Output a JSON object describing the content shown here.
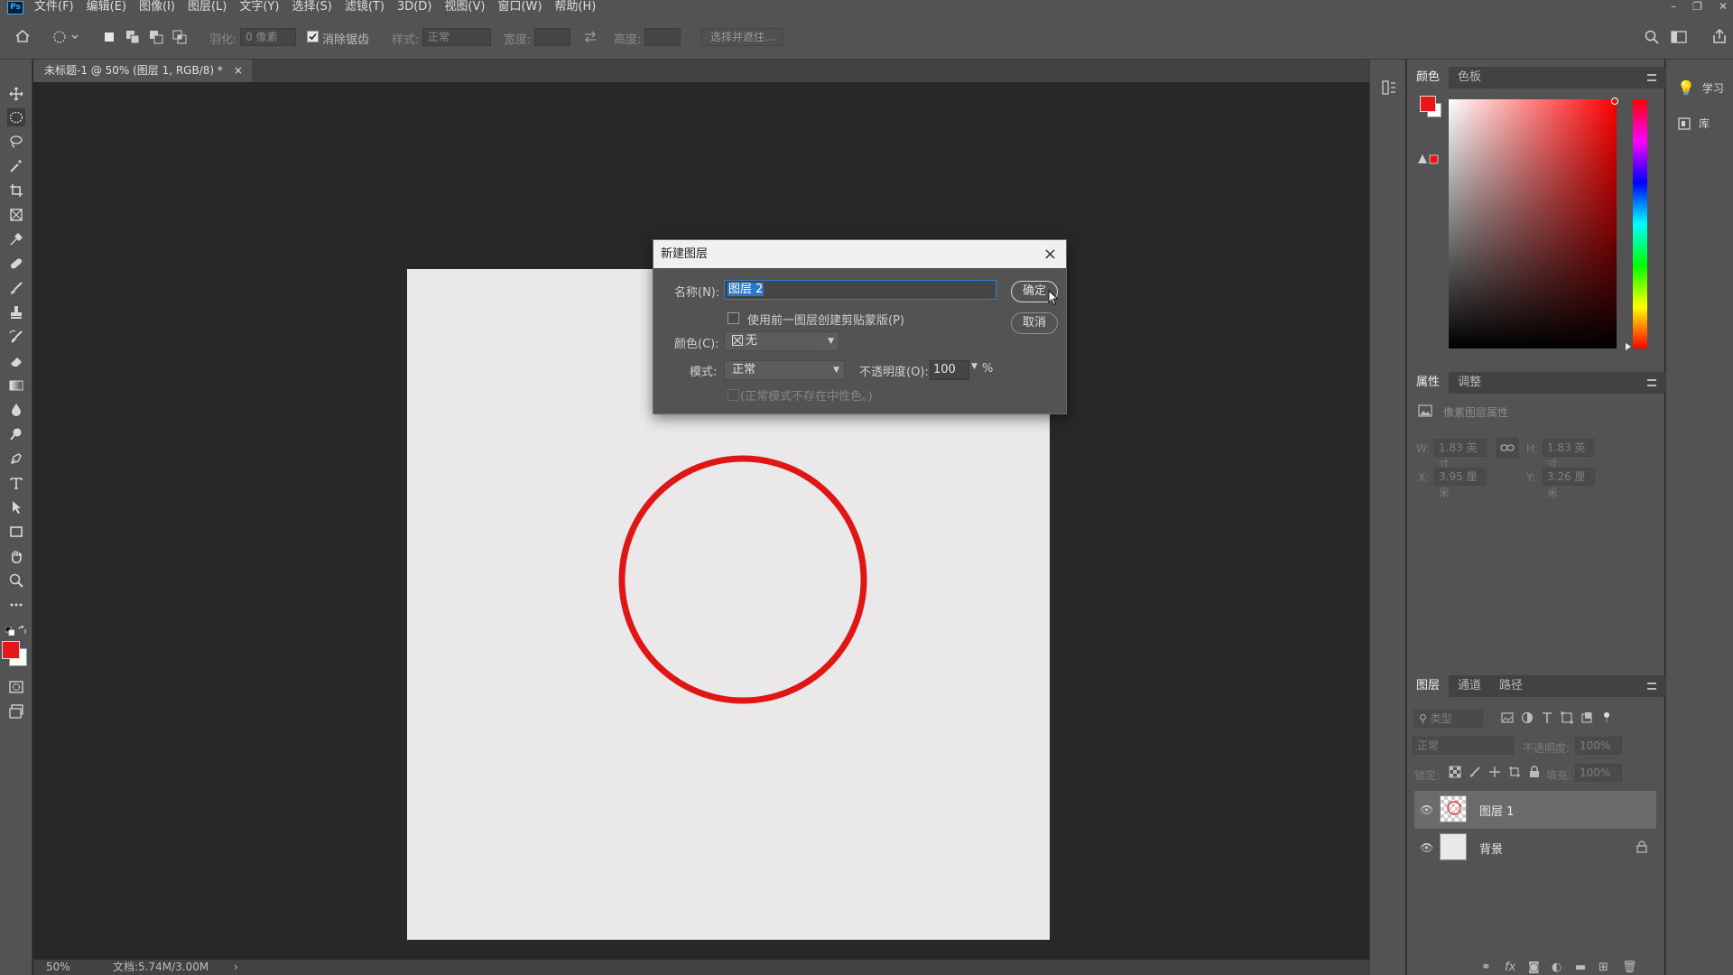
{
  "menu": {
    "items": [
      "文件(F)",
      "编辑(E)",
      "图像(I)",
      "图层(L)",
      "文字(Y)",
      "选择(S)",
      "滤镜(T)",
      "3D(D)",
      "视图(V)",
      "窗口(W)",
      "帮助(H)"
    ]
  },
  "options": {
    "feather_label": "羽化:",
    "feather_value": "0 像素",
    "antialias_label": "消除锯齿",
    "style_label": "样式:",
    "style_value": "正常",
    "width_label": "宽度:",
    "height_label": "高度:",
    "select_mask_button": "选择并遮住..."
  },
  "document": {
    "tab_title": "未标题-1 @ 50% (图层 1, RGB/8) *",
    "tab_close": "×",
    "circle_color": "#e01616"
  },
  "status": {
    "zoom": "50%",
    "doc_size": "文档:5.74M/3.00M",
    "arrow": "›"
  },
  "dialog": {
    "title": "新建图层",
    "close": "×",
    "name_label": "名称(N):",
    "name_value": "图层 2",
    "clip_mask_label": "使用前一图层创建剪贴蒙版(P)",
    "color_label": "颜色(C):",
    "color_value": "无",
    "mode_label": "模式:",
    "mode_value": "正常",
    "opacity_label": "不透明度(O):",
    "opacity_value": "100",
    "opacity_unit": "%",
    "neutral_note": "(正常模式不存在中性色。)",
    "ok_button": "确定",
    "cancel_button": "取消"
  },
  "color_panel": {
    "tabs": [
      "颜色",
      "色板"
    ],
    "foreground": "#e8161a",
    "background": "#ffffff",
    "hue": "#ff0000"
  },
  "properties_panel": {
    "tabs": [
      "属性",
      "调整"
    ],
    "section": "像素图层属性",
    "w_label": "W:",
    "w_value": "1.83 英寸",
    "h_label": "H:",
    "h_value": "1.83 英寸",
    "x_label": "X:",
    "x_value": "3.95 厘米",
    "y_label": "Y:",
    "y_value": "3.26 厘米"
  },
  "layers_panel": {
    "tabs": [
      "图层",
      "通道",
      "路径"
    ],
    "filter_placeholder": "类型",
    "blend_mode": "正常",
    "opacity_label": "不透明度:",
    "opacity_value": "100%",
    "lock_label": "锁定:",
    "fill_label": "填充:",
    "fill_value": "100%",
    "layers": [
      {
        "name": "图层 1"
      },
      {
        "name": "背景"
      }
    ]
  },
  "right_strip": {
    "learn": "学习",
    "library": "库"
  }
}
